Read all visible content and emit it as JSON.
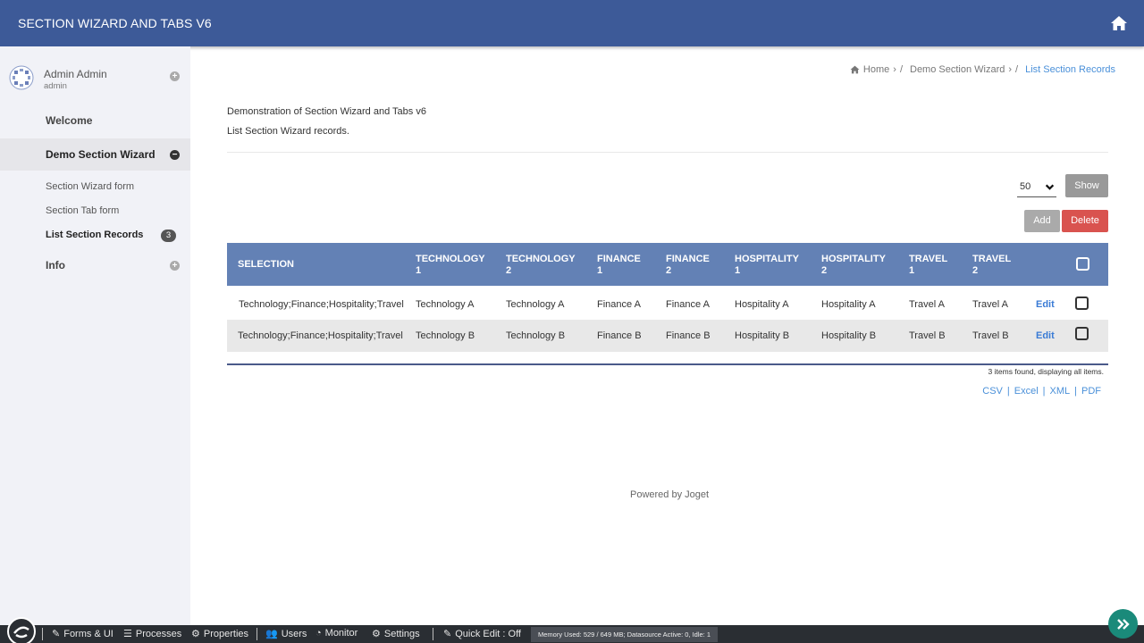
{
  "header": {
    "title": "SECTION WIZARD AND TABS V6"
  },
  "sidebar": {
    "user": {
      "name": "Admin Admin",
      "login": "admin"
    },
    "items": {
      "welcome": "Welcome",
      "demo": "Demo Section Wizard",
      "info": "Info"
    },
    "subitems": {
      "form": "Section Wizard form",
      "tab": "Section Tab form",
      "list": "List Section Records",
      "list_badge": "3"
    }
  },
  "breadcrumb": {
    "home": "Home",
    "demo": "Demo Section Wizard",
    "current": "List Section Records",
    "sep": "/"
  },
  "content": {
    "description": "Demonstration of Section Wizard and Tabs v6",
    "subtitle": "List Section Wizard records."
  },
  "toolbar": {
    "page_size": "50",
    "show": "Show",
    "add": "Add",
    "delete": "Delete"
  },
  "table": {
    "headers": {
      "selection": "SELECTION",
      "tech1a": "TECHNOLOGY",
      "tech1b": "1",
      "tech2a": "TECHNOLOGY",
      "tech2b": "2",
      "fin1a": "FINANCE",
      "fin1b": "1",
      "fin2a": "FINANCE",
      "fin2b": "2",
      "hosp1a": "HOSPITALITY",
      "hosp1b": "1",
      "hosp2a": "HOSPITALITY",
      "hosp2b": "2",
      "trav1a": "TRAVEL",
      "trav1b": "1",
      "trav2a": "TRAVEL",
      "trav2b": "2"
    },
    "rows": [
      {
        "selection": "Technology;Finance;Hospitality;Travel",
        "tech1": "Technology A",
        "tech2": "Technology A",
        "fin1": "Finance A",
        "fin2": "Finance A",
        "hosp1": "Hospitality A",
        "hosp2": "Hospitality A",
        "trav1": "Travel A",
        "trav2": "Travel A",
        "edit": "Edit"
      },
      {
        "selection": "Technology;Finance;Hospitality;Travel",
        "tech1": "Technology B",
        "tech2": "Technology B",
        "fin1": "Finance B",
        "fin2": "Finance B",
        "hosp1": "Hospitality B",
        "hosp2": "Hospitality B",
        "trav1": "Travel B",
        "trav2": "Travel B",
        "edit": "Edit"
      }
    ],
    "found": "3 items found, displaying all items."
  },
  "exports": {
    "csv": "CSV",
    "excel": "Excel",
    "xml": "XML",
    "pdf": "PDF",
    "sep": "|"
  },
  "footer": {
    "powered": "Powered by Joget"
  },
  "bottombar": {
    "forms": "Forms & UI",
    "processes": "Processes",
    "properties": "Properties",
    "users": "Users",
    "monitor": "Monitor",
    "settings": "Settings",
    "quick_edit": "Quick Edit : Off",
    "memory": "Memory Used: 529 / 649 MB; Datasource Active: 0, Idle: 1"
  },
  "colors": {
    "header": "#3d5a98",
    "table_header": "#6381b5",
    "delete": "#d9534f",
    "link": "#4a90d9",
    "fab": "#1a8a7a"
  }
}
